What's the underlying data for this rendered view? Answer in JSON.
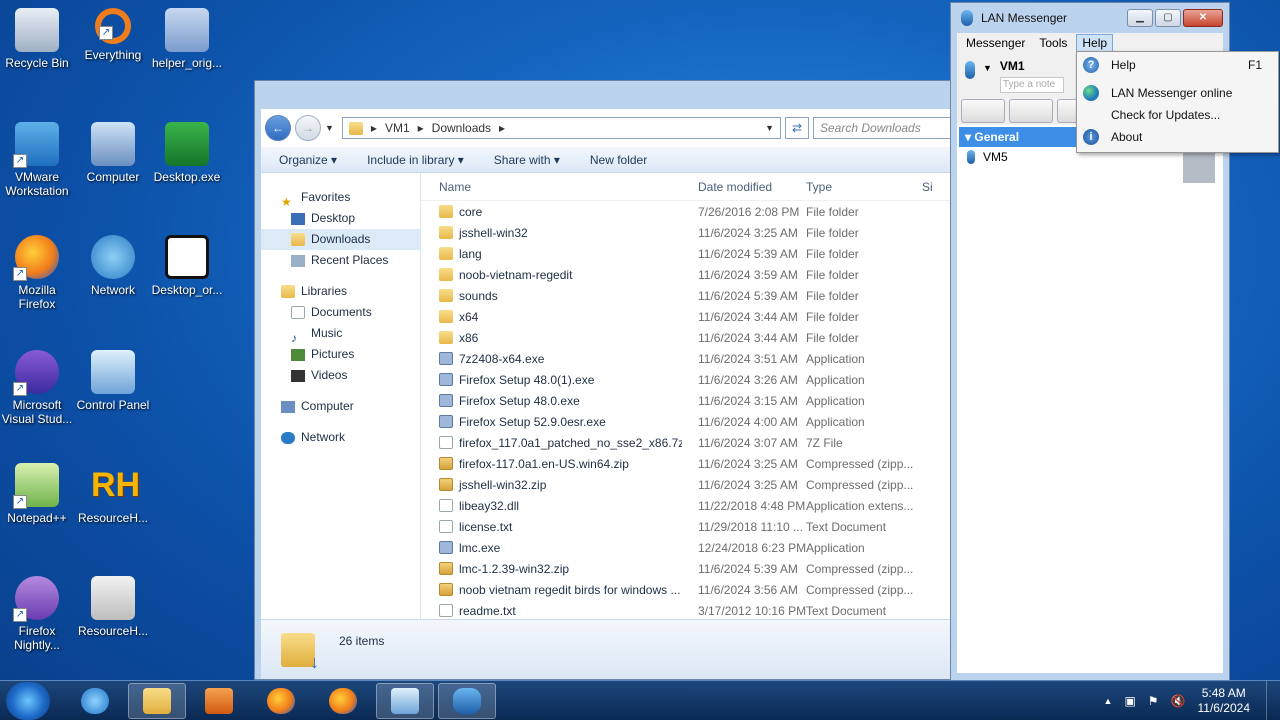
{
  "desktop": {
    "icons": [
      {
        "label": "Recycle Bin"
      },
      {
        "label": "Everything"
      },
      {
        "label": "helper_orig..."
      },
      {
        "label": "VMware Workstation"
      },
      {
        "label": "Computer"
      },
      {
        "label": "Desktop.exe"
      },
      {
        "label": "Mozilla Firefox"
      },
      {
        "label": "Network"
      },
      {
        "label": "Desktop_or..."
      },
      {
        "label": "Microsoft Visual Stud..."
      },
      {
        "label": "Control Panel"
      },
      {
        "label": "Notepad++"
      },
      {
        "label": "ResourceH..."
      },
      {
        "label": "Firefox Nightly..."
      },
      {
        "label": "ResourceH..."
      }
    ]
  },
  "explorer": {
    "breadcrumb": [
      "VM1",
      "Downloads"
    ],
    "search_placeholder": "Search Downloads",
    "commands": [
      "Organize",
      "Include in library",
      "Share with",
      "New folder"
    ],
    "nav": {
      "favorites": "Favorites",
      "desktop": "Desktop",
      "downloads": "Downloads",
      "recent": "Recent Places",
      "libraries": "Libraries",
      "documents": "Documents",
      "music": "Music",
      "pictures": "Pictures",
      "videos": "Videos",
      "computer": "Computer",
      "network": "Network"
    },
    "columns": [
      "Name",
      "Date modified",
      "Type",
      "Si"
    ],
    "files": [
      {
        "name": "core",
        "date": "7/26/2016 2:08 PM",
        "type": "File folder",
        "icon": "folder"
      },
      {
        "name": "jsshell-win32",
        "date": "11/6/2024 3:25 AM",
        "type": "File folder",
        "icon": "folder"
      },
      {
        "name": "lang",
        "date": "11/6/2024 5:39 AM",
        "type": "File folder",
        "icon": "folder"
      },
      {
        "name": "noob-vietnam-regedit",
        "date": "11/6/2024 3:59 AM",
        "type": "File folder",
        "icon": "folder"
      },
      {
        "name": "sounds",
        "date": "11/6/2024 5:39 AM",
        "type": "File folder",
        "icon": "folder"
      },
      {
        "name": "x64",
        "date": "11/6/2024 3:44 AM",
        "type": "File folder",
        "icon": "folder"
      },
      {
        "name": "x86",
        "date": "11/6/2024 3:44 AM",
        "type": "File folder",
        "icon": "folder"
      },
      {
        "name": "7z2408-x64.exe",
        "date": "11/6/2024 3:51 AM",
        "type": "Application",
        "icon": "app"
      },
      {
        "name": "Firefox Setup 48.0(1).exe",
        "date": "11/6/2024 3:26 AM",
        "type": "Application",
        "icon": "app"
      },
      {
        "name": "Firefox Setup 48.0.exe",
        "date": "11/6/2024 3:15 AM",
        "type": "Application",
        "icon": "app"
      },
      {
        "name": "Firefox Setup 52.9.0esr.exe",
        "date": "11/6/2024 4:00 AM",
        "type": "Application",
        "icon": "app"
      },
      {
        "name": "firefox_117.0a1_patched_no_sse2_x86.7z",
        "date": "11/6/2024 3:07 AM",
        "type": "7Z File",
        "icon": "txt"
      },
      {
        "name": "firefox-117.0a1.en-US.win64.zip",
        "date": "11/6/2024 3:25 AM",
        "type": "Compressed (zipp...",
        "icon": "zip"
      },
      {
        "name": "jsshell-win32.zip",
        "date": "11/6/2024 3:25 AM",
        "type": "Compressed (zipp...",
        "icon": "zip"
      },
      {
        "name": "libeay32.dll",
        "date": "11/22/2018 4:48 PM",
        "type": "Application extens...",
        "icon": "txt"
      },
      {
        "name": "license.txt",
        "date": "11/29/2018 11:10 ...",
        "type": "Text Document",
        "icon": "txt"
      },
      {
        "name": "lmc.exe",
        "date": "12/24/2018 6:23 PM",
        "type": "Application",
        "icon": "app"
      },
      {
        "name": "lmc-1.2.39-win32.zip",
        "date": "11/6/2024 5:39 AM",
        "type": "Compressed (zipp...",
        "icon": "zip"
      },
      {
        "name": "noob vietnam regedit birds for windows ...",
        "date": "11/6/2024 3:56 AM",
        "type": "Compressed (zipp...",
        "icon": "zip"
      },
      {
        "name": "readme.txt",
        "date": "3/17/2012 10:16 PM",
        "type": "Text Document",
        "icon": "txt"
      }
    ],
    "status_count": "26 items"
  },
  "lan": {
    "title": "LAN Messenger",
    "menu": [
      "Messenger",
      "Tools",
      "Help"
    ],
    "user": "VM1",
    "note_placeholder": "Type a note",
    "group": "General",
    "contacts": [
      "VM5"
    ]
  },
  "help_menu": {
    "items": [
      {
        "label": "Help",
        "key": "F1"
      },
      {
        "label": "LAN Messenger online"
      },
      {
        "label": "Check for Updates..."
      },
      {
        "label": "About"
      }
    ]
  },
  "taskbar": {
    "time": "5:48 AM",
    "date": "11/6/2024"
  },
  "colors": {
    "accent": "#3d8ee6",
    "desktop": "#1566c0"
  }
}
